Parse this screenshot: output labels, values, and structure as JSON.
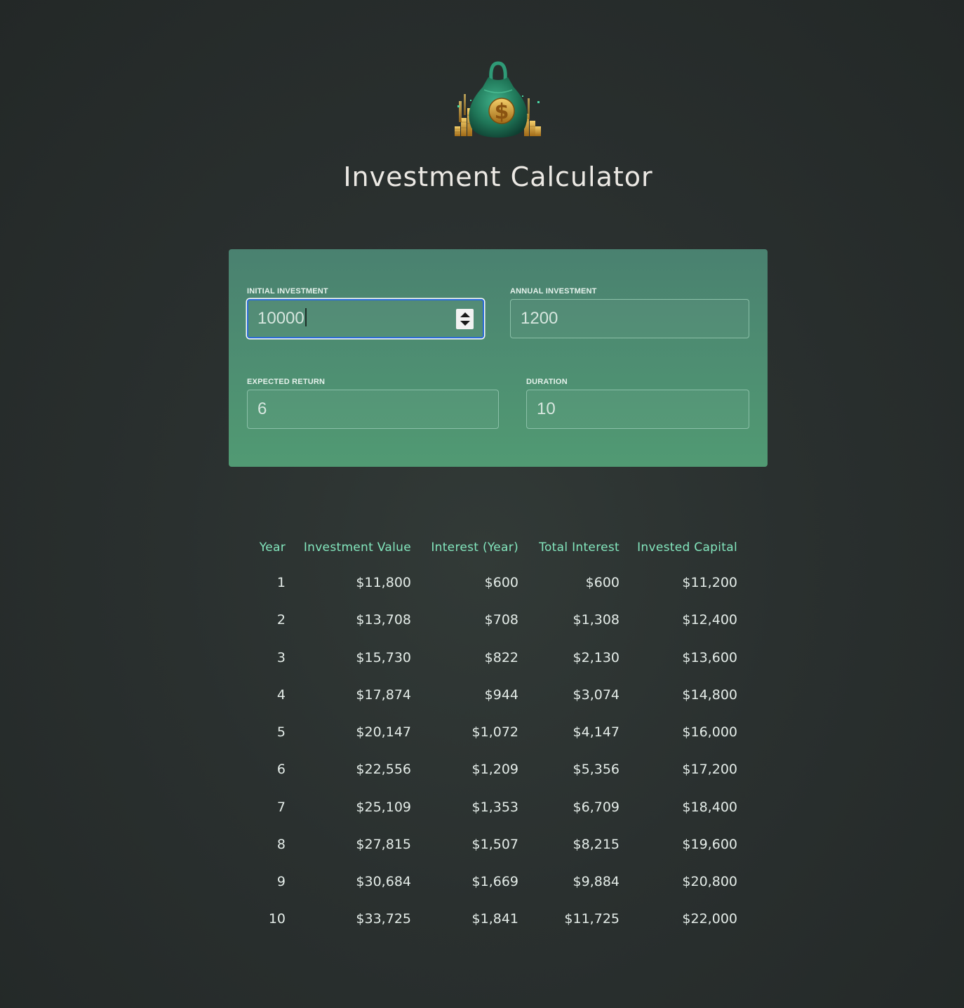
{
  "header": {
    "logo_icon": "money-bag-icon",
    "title": "Investment Calculator"
  },
  "inputs": {
    "initial_investment": {
      "label": "INITIAL INVESTMENT",
      "value": "10000"
    },
    "annual_investment": {
      "label": "ANNUAL INVESTMENT",
      "value": "1200"
    },
    "expected_return": {
      "label": "EXPECTED RETURN",
      "value": "6"
    },
    "duration": {
      "label": "DURATION",
      "value": "10"
    }
  },
  "results": {
    "headers": [
      "Year",
      "Investment Value",
      "Interest (Year)",
      "Total Interest",
      "Invested Capital"
    ],
    "rows": [
      [
        "1",
        "$11,800",
        "$600",
        "$600",
        "$11,200"
      ],
      [
        "2",
        "$13,708",
        "$708",
        "$1,308",
        "$12,400"
      ],
      [
        "3",
        "$15,730",
        "$822",
        "$2,130",
        "$13,600"
      ],
      [
        "4",
        "$17,874",
        "$944",
        "$3,074",
        "$14,800"
      ],
      [
        "5",
        "$20,147",
        "$1,072",
        "$4,147",
        "$16,000"
      ],
      [
        "6",
        "$22,556",
        "$1,209",
        "$5,356",
        "$17,200"
      ],
      [
        "7",
        "$25,109",
        "$1,353",
        "$6,709",
        "$18,400"
      ],
      [
        "8",
        "$27,815",
        "$1,507",
        "$8,215",
        "$19,600"
      ],
      [
        "9",
        "$30,684",
        "$1,669",
        "$9,884",
        "$20,800"
      ],
      [
        "10",
        "$33,725",
        "$1,841",
        "$11,725",
        "$22,000"
      ]
    ]
  },
  "colors": {
    "background": "#2a302f",
    "panel_top": "#4a8170",
    "panel_bottom": "#519a73",
    "table_header": "#83e6bd",
    "focus_ring": "#2a6bd8"
  }
}
